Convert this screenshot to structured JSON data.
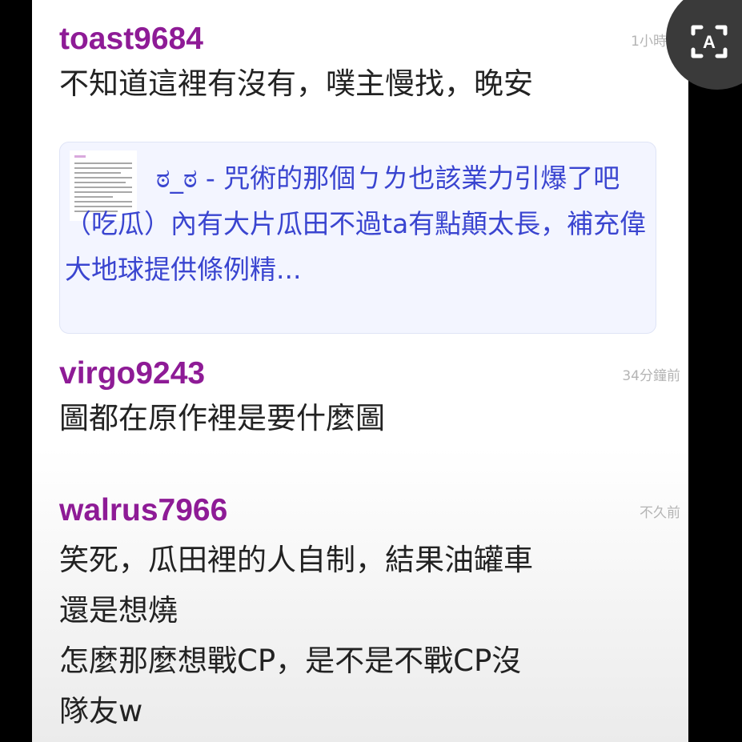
{
  "comments": [
    {
      "username": "toast9684",
      "timestamp": "1小時前",
      "text": "不知道這裡有沒有，噗主慢找，晚安",
      "link": {
        "title": "ಠ_ಠ - 咒術的那個ㄅㄌ也該業力引爆了吧（吃瓜）內有大片瓜田不過ta有點顛太長，補充偉大地球提供條例精..."
      }
    },
    {
      "username": "virgo9243",
      "timestamp": "34分鐘前",
      "text": "圖都在原作裡是要什麼圖"
    },
    {
      "username": "walrus7966",
      "timestamp": "不久前",
      "lines": [
        "笑死，瓜田裡的人自制，結果油罐車",
        "還是想燒",
        "怎麼那麼想戰CP，是不是不戰CP沒",
        "隊友w"
      ]
    }
  ],
  "overlay": {
    "icon": "text-recognition-icon",
    "letter": "A",
    "background": "#3a3a3a"
  },
  "colors": {
    "username": "#8e1b96",
    "link": "#3a45d0",
    "timestamp": "#b4b4b4"
  }
}
